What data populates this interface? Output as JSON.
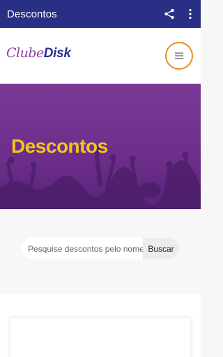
{
  "appbar": {
    "title": "Descontos",
    "share_icon": "share-icon",
    "more_icon": "more-vert-icon",
    "background": "#2a2f86"
  },
  "header": {
    "logo_part1": "Clube",
    "logo_part2": "Disk",
    "menu_icon": "hamburger-menu-icon",
    "menu_ring_color": "#ee8a22"
  },
  "hero": {
    "title": "Descontos",
    "overlay_color": "#7c3c98",
    "title_color": "#f2c51d"
  },
  "search": {
    "placeholder": "Pesquise descontos pelo nome",
    "button_label": "Buscar"
  }
}
